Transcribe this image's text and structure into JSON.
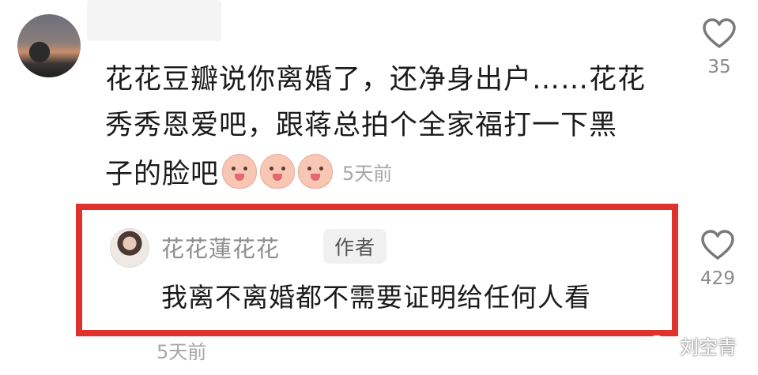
{
  "comment": {
    "lines": [
      "花花豆瓣说你离婚了，还净身出户……花花",
      "秀秀恩爱吧，跟蒋总拍个全家福打一下黑",
      "子的脸吧"
    ],
    "emoji_count": 3,
    "emoji_icon": "piglet-face-icon",
    "time": "5天前",
    "likes": "35"
  },
  "reply": {
    "username": "花花蓮花花",
    "badge": "作者",
    "text": "我离不离婚都不需要证明给任何人看",
    "time": "5天前",
    "likes": "429"
  },
  "watermark": {
    "icon": "wechat-icon",
    "text": "刘空青"
  },
  "colors": {
    "highlight_border": "#e0322d",
    "time_text": "#a7a7a7",
    "like_count": "#8a8a8a"
  }
}
